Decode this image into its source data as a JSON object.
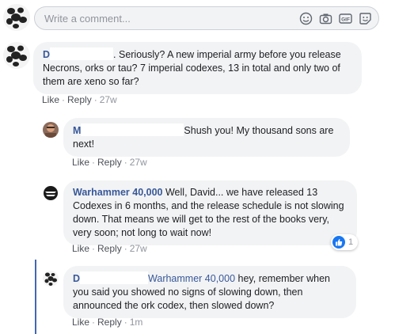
{
  "composer": {
    "placeholder": "Write a comment...",
    "icons": [
      "emoji-icon",
      "camera-icon",
      "gif-icon",
      "sticker-icon"
    ]
  },
  "comments": [
    {
      "author": "D",
      "text": ". Seriously? A new imperial army before you release Necrons, orks or tau? 7 imperial codexes, 13 in total and only two of them are xeno so far?",
      "like": "Like",
      "reply": "Reply",
      "time": "27w"
    },
    {
      "author": "M",
      "text": "Shush you! My thousand sons are next!",
      "like": "Like",
      "reply": "Reply",
      "time": "27w"
    },
    {
      "author": "Warhammer 40,000",
      "text": "Well, David... we have released 13 Codexes in 6 months, and the release schedule is not slowing down. That means we will get to the rest of the books very, very soon; not long to wait now!",
      "like": "Like",
      "reply": "Reply",
      "time": "27w",
      "reaction_count": "1"
    },
    {
      "author": "D",
      "mention": "Warhammer 40,000",
      "text": "hey, remember when you said you showed no signs of slowing down, then announced the ork codex, then slowed down?",
      "like": "Like",
      "reply": "Reply",
      "time": "1m"
    }
  ],
  "colors": {
    "link_blue": "#385898",
    "bubble_bg": "#f2f3f5",
    "meta_gray": "#90949c",
    "thread_line": "#4267b2",
    "like_badge": "#1877f2"
  }
}
